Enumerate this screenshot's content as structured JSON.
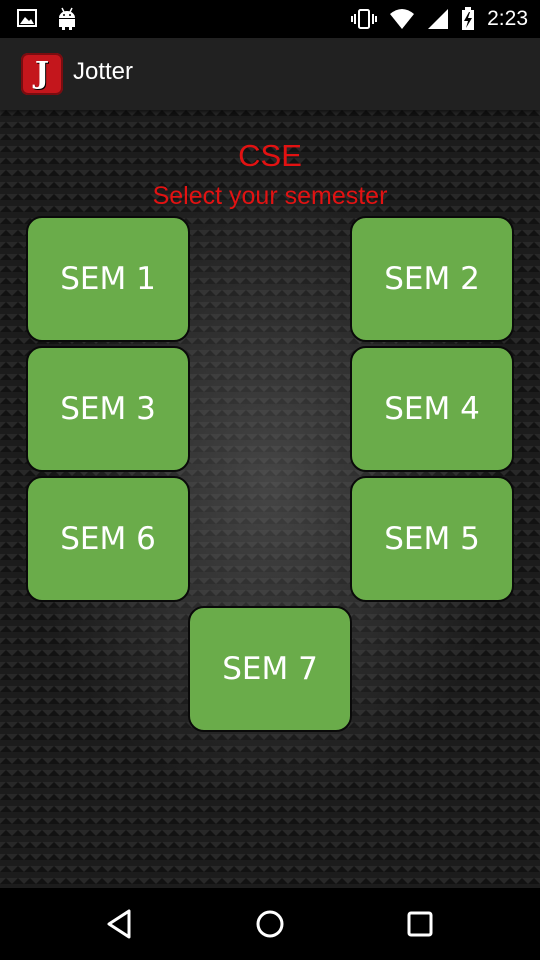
{
  "status_bar": {
    "time": "2:23",
    "icons": [
      "image-notification-icon",
      "android-notification-icon",
      "vibrate-icon",
      "wifi-icon",
      "signal-icon",
      "battery-charging-icon"
    ]
  },
  "action_bar": {
    "app_icon_letter": "J",
    "title": "Jotter"
  },
  "main": {
    "department": "CSE",
    "subtitle": "Select your semester",
    "semesters": [
      "SEM 1",
      "SEM 2",
      "SEM 3",
      "SEM 4",
      "SEM 6",
      "SEM 5",
      "SEM 7"
    ]
  },
  "colors": {
    "accent_text": "#e21212",
    "button_green": "#6aac4a",
    "app_icon_red": "#c4161c"
  },
  "nav_bar": {
    "icons": [
      "back-icon",
      "home-icon",
      "recents-icon"
    ]
  }
}
